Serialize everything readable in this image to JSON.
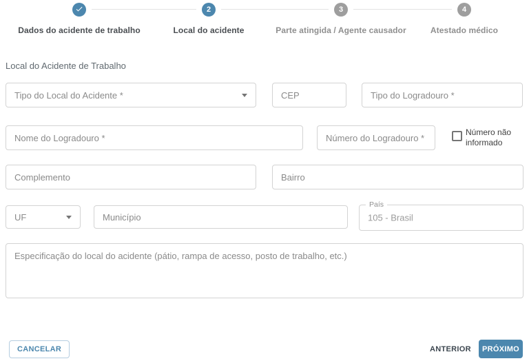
{
  "stepper": {
    "steps": [
      {
        "label": "Dados do acidente de trabalho",
        "number": "",
        "state": "completed",
        "icon": "check-icon"
      },
      {
        "label": "Local do acidente",
        "number": "2",
        "state": "active"
      },
      {
        "label": "Parte atingida / Agente causador",
        "number": "3",
        "state": "inactive"
      },
      {
        "label": "Atestado médico",
        "number": "4",
        "state": "inactive"
      }
    ]
  },
  "form": {
    "section_title": "Local do Acidente de Trabalho",
    "tipo_local_acidente": {
      "placeholder": "Tipo do Local do Acidente *"
    },
    "cep": {
      "placeholder": "CEP"
    },
    "tipo_logradouro": {
      "placeholder": "Tipo do Logradouro *"
    },
    "nome_logradouro": {
      "placeholder": "Nome do Logradouro *"
    },
    "numero_logradouro": {
      "placeholder": "Número do Logradouro *"
    },
    "numero_nao_informado": {
      "label": "Número não informado",
      "checked": false
    },
    "complemento": {
      "placeholder": "Complemento"
    },
    "bairro": {
      "placeholder": "Bairro"
    },
    "uf": {
      "placeholder": "UF"
    },
    "municipio": {
      "placeholder": "Município"
    },
    "pais": {
      "label": "País",
      "value": "105 - Brasil",
      "disabled": true
    },
    "especificacao": {
      "placeholder": "Especificação do local do acidente (pátio, rampa de acesso, posto de trabalho, etc.)"
    }
  },
  "actions": {
    "cancel": "CANCELAR",
    "previous": "ANTERIOR",
    "next": "PRÓXIMO"
  },
  "colors": {
    "accent_blue": "#4c87ae",
    "inactive_gray": "#9e9e9e",
    "border_gray": "#d3d3d3",
    "connector_gray": "#e3e3e3"
  }
}
